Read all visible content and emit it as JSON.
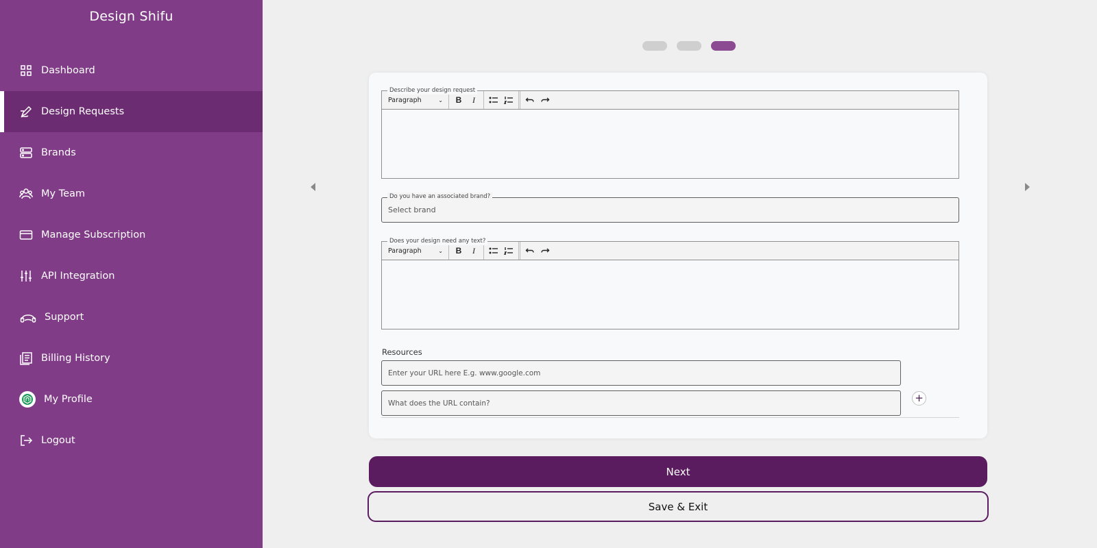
{
  "app": {
    "title": "Design Shifu"
  },
  "sidebar": {
    "items": [
      {
        "label": "Dashboard",
        "icon": "grid-icon"
      },
      {
        "label": "Design Requests",
        "icon": "pen-icon",
        "active": true
      },
      {
        "label": "Brands",
        "icon": "server-icon"
      },
      {
        "label": "My Team",
        "icon": "team-icon"
      },
      {
        "label": "Manage Subscription",
        "icon": "card-icon"
      },
      {
        "label": "API Integration",
        "icon": "sliders-icon"
      },
      {
        "label": "Support",
        "icon": "headset-icon"
      },
      {
        "label": "Billing History",
        "icon": "documents-icon"
      },
      {
        "label": "My Profile",
        "icon": "profile-avatar-icon"
      },
      {
        "label": "Logout",
        "icon": "logout-icon"
      }
    ]
  },
  "stepper": {
    "total": 3,
    "current": 3
  },
  "form": {
    "description_editor": {
      "legend": "Describe your design request",
      "block_format": "Paragraph"
    },
    "brand_select": {
      "legend": "Do you have an associated brand?",
      "placeholder": "Select brand"
    },
    "text_editor": {
      "legend": "Does your design need any text?",
      "block_format": "Paragraph"
    },
    "resources": {
      "label": "Resources",
      "url_placeholder": "Enter your URL here E.g. www.google.com",
      "desc_placeholder": "What does the URL contain?",
      "add_symbol": "+"
    }
  },
  "actions": {
    "next_label": "Next",
    "save_exit_label": "Save & Exit"
  },
  "colors": {
    "sidebar_bg": "#803c86",
    "sidebar_active": "#6c2c72",
    "primary": "#5a1c5f",
    "step_active": "#8c4a93",
    "step_inactive": "#cfcfcf",
    "page_bg": "#efefef"
  }
}
